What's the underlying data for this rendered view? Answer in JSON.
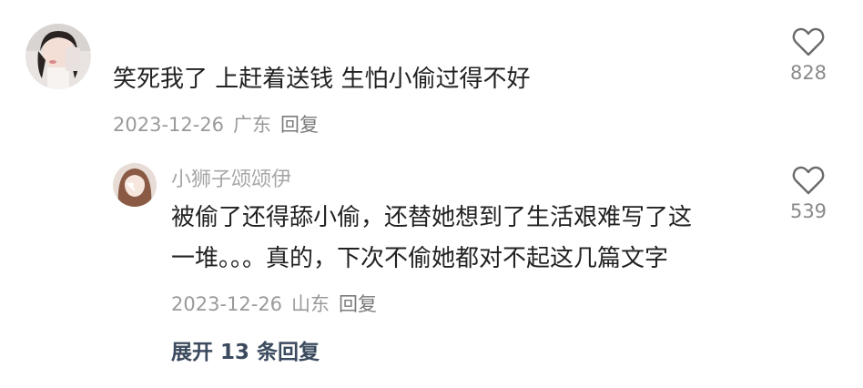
{
  "comment": {
    "text": "笑死我了 上赶着送钱 生怕小偷过得不好",
    "date": "2023-12-26",
    "location": "广东",
    "reply_label": "回复",
    "likes": "828"
  },
  "reply": {
    "username": "小狮子颂颂伊",
    "text_line1": "被偷了还得舔小偷，还替她想到了生活艰难写了这",
    "text_line2": "一堆。。。真的，下次不偷她都对不起这几篇文字",
    "date": "2023-12-26",
    "location": "山东",
    "reply_label": "回复",
    "likes": "539"
  },
  "expand_label": "展开 13 条回复",
  "icons": {
    "like": "heart-outline-icon"
  }
}
